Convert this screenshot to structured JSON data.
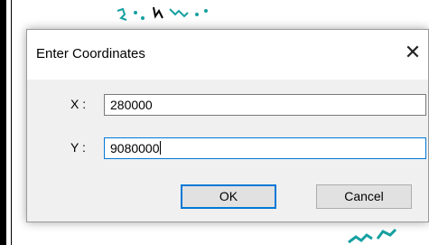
{
  "dialog": {
    "title": "Enter Coordinates",
    "close_symbol": "✕",
    "fields": {
      "x_label": "X :",
      "x_value": "280000",
      "y_label": "Y :",
      "y_value": "9080000"
    },
    "buttons": {
      "ok_label": "OK",
      "cancel_label": "Cancel"
    }
  },
  "colors": {
    "focus_accent": "#0078d7",
    "map_feature": "#16a0a0"
  }
}
